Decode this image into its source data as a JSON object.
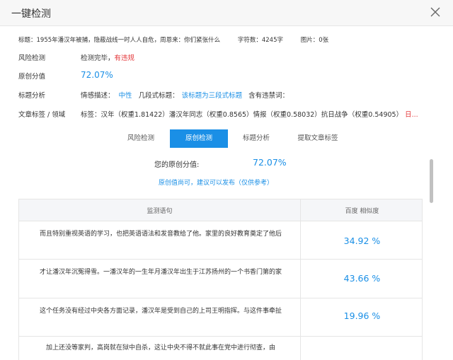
{
  "dialog": {
    "title": "一键检测"
  },
  "meta": {
    "title": "标题：1955年潘汉年被捕，隐蔽战线一时人人自危，周恩来：你们紧张什么",
    "chars": "字符数：4245字",
    "images": "图片：0张"
  },
  "risk": {
    "label": "风险检测",
    "status": "检测完毕，",
    "warning": "有违规"
  },
  "originality": {
    "label": "原创分值",
    "value": "72.07%"
  },
  "title_analysis": {
    "label": "标题分析",
    "sentiment_label": "情感描述：",
    "sentiment_value": "中性",
    "segment_label": "几段式标题：",
    "segment_value": "该标题为三段式标题",
    "forbidden_label": "含有违禁词："
  },
  "tags": {
    "label": "文章标签 / 领域",
    "text": "标签：汉年（权重1.81422）潘汉年同志（权重0.8565）情报（权重0.58032）抗日战争（权重0.54905）",
    "more": "日..."
  },
  "tabs": [
    {
      "label": "风险检测"
    },
    {
      "label": "原创检测"
    },
    {
      "label": "标题分析"
    },
    {
      "label": "提取文章标签"
    }
  ],
  "original_panel": {
    "score_label": "您的原创分值:",
    "score_value": "72.07%",
    "hint": "原创值尚可，建议可以发布（仅供参考）"
  },
  "table": {
    "headers": [
      "监测语句",
      "百度 相似度"
    ],
    "rows": [
      {
        "sentence": "而且特别重视英语的学习，也把英语语法和发音教给了他。家里的良好教育奠定了他后",
        "similarity": "34.92 %"
      },
      {
        "sentence": "才让潘汉年沉冤得雪。一潘汉年的一生年月潘汉年出生于江苏扬州的一个书香门第的家",
        "similarity": "43.66 %"
      },
      {
        "sentence": "这个任务没有经过中央各方面记录，潘汉年是受到自己的上司王明指挥。与这件事牵扯",
        "similarity": "19.96 %"
      },
      {
        "sentence": "加上还没等家判，高岗就在狱中自杀，这让中央不得不就此事在党中进行彻查，由",
        "similarity": ""
      }
    ]
  },
  "colors": {
    "accent": "#1a8fe6",
    "warning": "#e4393c"
  }
}
